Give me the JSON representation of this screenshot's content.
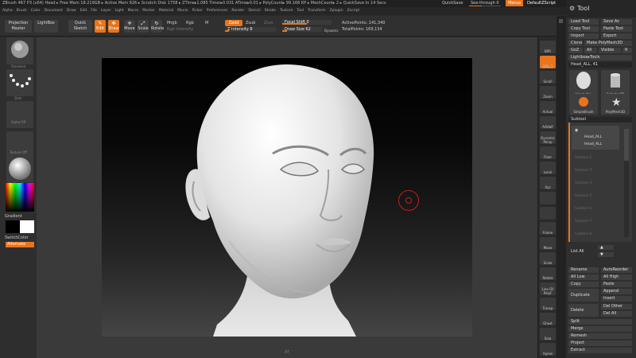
{
  "titlebar": {
    "title": "ZBrush 4R7 P3 (x64)   Head   ▸ Free Mem 18.219GB ▸ Active Mem 926 ▸ Scratch Disk 1758 ▸ ZTime▸1.085 Timer▸0.031 ATime▸0.01 ▸ PolyCount▸ 99.168 KP ▸ MeshCount▸ 2 ▸ QuickSave In 14 Secs",
    "quicksave": "QuickSave",
    "see_through": "See-through 0",
    "see_through_fraction": 0.4,
    "menus_label": "Menus",
    "default_script": "DefaultZScript"
  },
  "menubar": [
    "Alpha",
    "Brush",
    "Color",
    "Document",
    "Draw",
    "Edit",
    "File",
    "Layer",
    "Light",
    "Macro",
    "Marker",
    "Material",
    "Movie",
    "Picker",
    "Preferences",
    "Render",
    "Stencil",
    "Stroke",
    "Texture",
    "Tool",
    "Transform",
    "Zplugin",
    "Zscript"
  ],
  "toolbar": {
    "projection_master": "Projection Master",
    "lightbox": "LightBox",
    "quick_sketch": "Quick Sketch",
    "edit": "Edit",
    "draw": "Draw",
    "move": "Move",
    "scale": "Scale",
    "rotate": "Rotate",
    "mrgb": "Mrgb",
    "rgb": "Rgb",
    "m": "M",
    "rgb_intensity": "Rgb Intensity",
    "zadd": "Zadd",
    "zsub": "Zsub",
    "zcut": "Zcut",
    "z_intensity": "Z Intensity 8",
    "z_intensity_fraction": 0.08,
    "focal_shift": "Focal Shift 0",
    "focal_shift_fraction": 0.5,
    "draw_size": "Draw Size 62",
    "draw_size_fraction": 0.12,
    "dynamic": "Dynamic",
    "active_points": "ActivePoints: 141,340",
    "total_points": "TotalPoints: 169,134"
  },
  "left": {
    "brush_label": "Standard",
    "stroke_label": "Dots",
    "alpha_label": "Alpha Off",
    "texture_label": "Texture Off",
    "material_label": "MatCap Gray",
    "gradient": "Gradient",
    "switch_color": "SwitchColor",
    "alternate": "Alternate"
  },
  "right": {
    "buttons": [
      "BPR",
      "SPix 3",
      "Scroll",
      "Zoom",
      "Actual",
      "AAHalf",
      "Dynamic Persp",
      "Floor",
      "Local",
      "Xyz",
      "",
      "",
      "Frame",
      "Move",
      "Scale",
      "Rotate",
      "Line Fill PolyF",
      "Transp",
      "Ghost",
      "Solo",
      "Xpose"
    ],
    "spix_label": "SPix 3"
  },
  "tray": {
    "title": "Tool",
    "load_tool": "Load Tool",
    "save_as": "Save As",
    "copy_tool": "Copy Tool",
    "paste_tool": "Paste Tool",
    "import": "Import",
    "export": "Export",
    "clone": "Clone",
    "make_polymesh": "Make PolyMesh3D",
    "goz": "GoZ",
    "all": "All",
    "visible": "Visible",
    "r": "R",
    "lightbox_tools": "Lightbox▸Tools",
    "current_tool": "Head_ALL. 41",
    "thumbs": [
      "Head_ALL",
      "Cylinder3D",
      "SimpleBrush",
      "PolyMesh3D",
      "Head_ALL",
      ""
    ],
    "subtool_header": "Subtool",
    "subtool_items": [
      "Head_ALL",
      "Subtool 2",
      "Subtool 3",
      "Subtool 4",
      "Subtool 5",
      "Subtool 6",
      "Subtool 7",
      "Subtool 8"
    ],
    "subtool_first_sub": "Head_ALL",
    "list_all": "List All",
    "rename": "Rename",
    "autoreorder": "AutoReorder",
    "all_low": "All Low",
    "all_high": "All High",
    "copy": "Copy",
    "paste": "Paste",
    "duplicate": "Duplicate",
    "append": "Append",
    "insert": "Insert",
    "delete": "Delete",
    "del_other": "Del Other",
    "del_all": "Del All",
    "split": "Split",
    "merge": "Merge",
    "remesh": "Remesh",
    "project": "Project",
    "extract": "Extract"
  },
  "colors": {
    "accent": "#e8741c",
    "panel": "#2f2f2f",
    "canvas": "#3a3a3a"
  },
  "canvas": {
    "ruler_text": "AT"
  }
}
